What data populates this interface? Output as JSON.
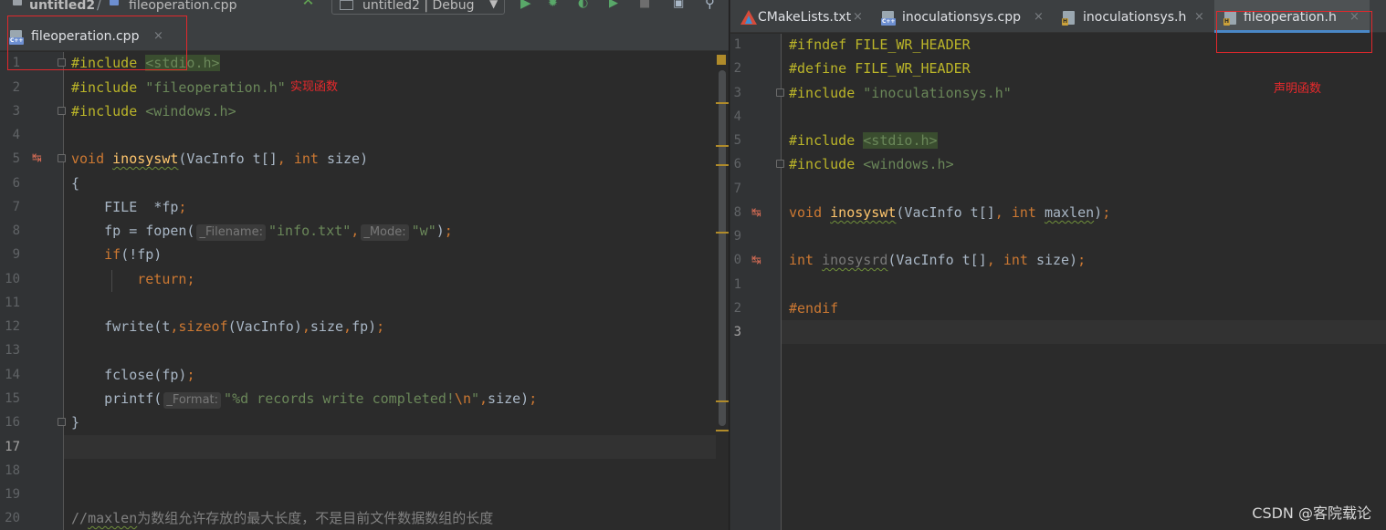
{
  "toolbar": {
    "project_name": "untitled2",
    "file_breadcrumb": "fileoperation.cpp",
    "run_config": "untitled2 | Debug"
  },
  "left_editor": {
    "tab": {
      "label": "fileoperation.cpp",
      "close": "×",
      "icon": "cpp-file-icon"
    },
    "line_numbers": [
      "1",
      "2",
      "3",
      "4",
      "5",
      "6",
      "7",
      "8",
      "9",
      "10",
      "11",
      "12",
      "13",
      "14",
      "15",
      "16",
      "17",
      "18",
      "19",
      "20"
    ],
    "code": {
      "l1_directive": "#include",
      "l1_header": "<stdio.h>",
      "l2_directive": "#include",
      "l2_header": "\"fileoperation.h\"",
      "l3_directive": "#include",
      "l3_header": "<windows.h>",
      "l5_void": "void",
      "l5_fn": "inosyswt",
      "l5_params1": "(VacInfo t[]",
      "l5_comma": ",",
      "l5_int": "int",
      "l5_params2": "size)",
      "l6": "{",
      "l7_type": "FILE",
      "l7_var": "*fp",
      "l7_semi": ";",
      "l8_a": "fp = fopen(",
      "l8_hint1": "_Filename:",
      "l8_str1": "\"info.txt\"",
      "l8_comma": ",",
      "l8_hint2": "_Mode:",
      "l8_str2": "\"w\"",
      "l8_close": ")",
      "l8_semi": ";",
      "l9_if": "if",
      "l9_rest": "(!fp)",
      "l10_return": "return",
      "l10_semi": ";",
      "l12_a": "fwrite(t",
      "l12_comma1": ",",
      "l12_sizeof": "sizeof",
      "l12_b": "(VacInfo)",
      "l12_comma2": ",",
      "l12_c": "size",
      "l12_comma3": ",",
      "l12_d": "fp)",
      "l12_semi": ";",
      "l14_a": "fclose(fp)",
      "l14_semi": ";",
      "l15_a": "printf(",
      "l15_hint": "_Format:",
      "l15_str": "\"%d records write completed!",
      "l15_esc": "\\n",
      "l15_strend": "\"",
      "l15_comma": ",",
      "l15_b": "size)",
      "l15_semi": ";",
      "l16": "}",
      "l20_comment_slashes": "//",
      "l20_comment_word": "maxlen",
      "l20_comment_rest": "为数组允许存放的最大长度，不是目前文件数据数组的长度"
    },
    "annotation": "实现函数"
  },
  "right_editor": {
    "tabs": [
      {
        "label": "CMakeLists.txt",
        "close": "×",
        "icon": "cmake-icon"
      },
      {
        "label": "inoculationsys.cpp",
        "close": "×",
        "icon": "cpp-file-icon"
      },
      {
        "label": "inoculationsys.h",
        "close": "×",
        "icon": "header-file-icon"
      },
      {
        "label": "fileoperation.h",
        "close": "×",
        "icon": "header-file-icon",
        "active": true
      }
    ],
    "line_numbers": [
      "1",
      "2",
      "3",
      "4",
      "5",
      "6",
      "7",
      "8",
      "9",
      "0",
      "1",
      "2",
      "3"
    ],
    "code": {
      "l1_directive": "#ifndef",
      "l1_macro": "FILE_WR_HEADER",
      "l2_directive": "#define",
      "l2_macro": "FILE_WR_HEADER",
      "l3_directive": "#include",
      "l3_header": "\"inoculationsys.h\"",
      "l5_directive": "#include",
      "l5_header": "<stdio.h>",
      "l6_directive": "#include",
      "l6_header": "<windows.h>",
      "l8_void": "void",
      "l8_fn": "inosyswt",
      "l8_params1": "(VacInfo t[]",
      "l8_comma": ",",
      "l8_int": "int",
      "l8_param2": "maxlen",
      "l8_close": ")",
      "l8_semi": ";",
      "l10_int1": "int",
      "l10_fn": "inosysrd",
      "l10_params1": "(VacInfo t[]",
      "l10_comma": ",",
      "l10_int2": "int",
      "l10_params2": "size)",
      "l10_semi": ";",
      "l12_directive": "#endif"
    },
    "annotation": "声明函数"
  },
  "watermark": "CSDN @客院载论",
  "colors": {
    "background": "#2b2b2b",
    "gutter": "#313335",
    "keyword": "#cc7832",
    "preprocessor": "#bbb529",
    "string": "#6a8759",
    "function": "#ffc66d",
    "annotation_red": "#e1282c",
    "active_tab_underline": "#4a88c7"
  }
}
